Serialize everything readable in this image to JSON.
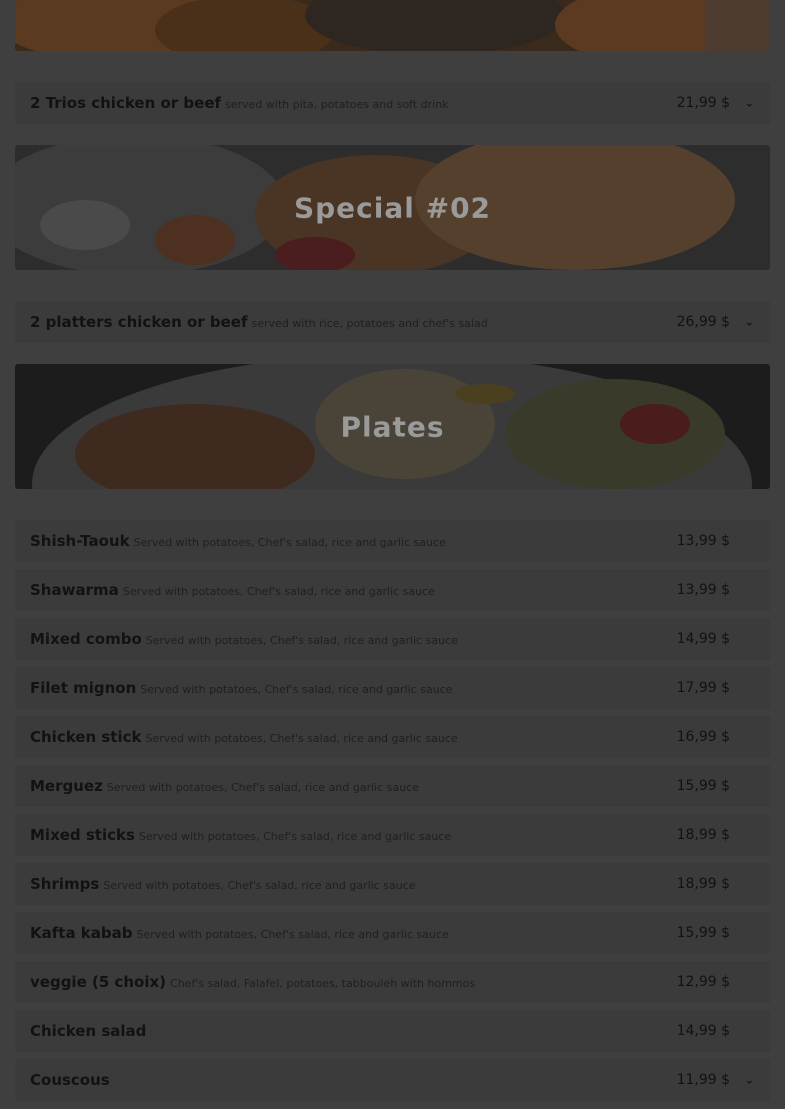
{
  "banners": {
    "special02": {
      "title": "Special #02"
    },
    "plates": {
      "title": "Plates"
    }
  },
  "specials": [
    {
      "name": "2 Trios chicken or beef",
      "desc": "served with pita, potatoes and soft drink",
      "price": "21,99 $"
    },
    {
      "name": "2 platters chicken or beef",
      "desc": "served with rice, potatoes and chef's salad",
      "price": "26,99 $"
    }
  ],
  "plates": [
    {
      "name": "Shish-Taouk",
      "desc": "Served with potatoes, Chef's salad, rice and garlic sauce",
      "price": "13,99 $"
    },
    {
      "name": "Shawarma",
      "desc": "Served with potatoes, Chef's salad, rice and garlic sauce",
      "price": "13,99 $"
    },
    {
      "name": "Mixed combo",
      "desc": "Served with potatoes, Chef's salad, rice and garlic sauce",
      "price": "14,99 $"
    },
    {
      "name": "Filet mignon",
      "desc": "Served with potatoes, Chef's salad, rice and garlic sauce",
      "price": "17,99 $"
    },
    {
      "name": "Chicken stick",
      "desc": "Served with potatoes, Chef's salad, rice and garlic sauce",
      "price": "16,99 $"
    },
    {
      "name": "Merguez",
      "desc": "Served with potatoes, Chef's salad, rice and garlic sauce",
      "price": "15,99 $"
    },
    {
      "name": "Mixed sticks",
      "desc": "Served with potatoes, Chef's salad, rice and garlic sauce",
      "price": "18,99 $"
    },
    {
      "name": "Shrimps",
      "desc": "Served with potatoes, Chef's salad, rice and garlic sauce",
      "price": "18,99 $"
    },
    {
      "name": "Kafta kabab",
      "desc": "Served with potatoes, Chef's salad, rice and garlic sauce",
      "price": "15,99 $"
    },
    {
      "name": "veggie (5 choix)",
      "desc": "Chef's salad, Falafel, potatoes, tabbouleh with hommos",
      "price": "12,99 $"
    },
    {
      "name": "Chicken salad",
      "desc": "",
      "price": "14,99 $"
    },
    {
      "name": "Couscous",
      "desc": "",
      "price": "11,99 $"
    }
  ],
  "icons": {
    "expand": "chevron-down-icon"
  },
  "colors": {
    "overlay": "#3f3f3f",
    "row": "#3b3b3b",
    "banner_text": "#9a9a9a"
  }
}
